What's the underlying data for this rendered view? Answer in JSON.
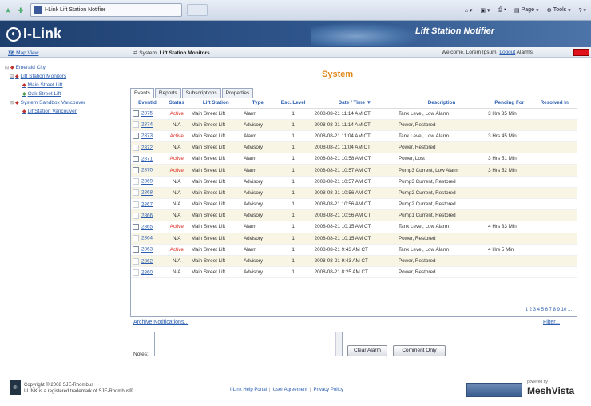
{
  "browser": {
    "tab_title": "I-Link Lift Station Notifier",
    "page_label": "Page",
    "tools_label": "Tools"
  },
  "banner": {
    "logo_text": "I-Link",
    "app_title": "Lift Station Notifier"
  },
  "subbar": {
    "map_view": "Map View",
    "system_prefix": "System:",
    "system_name": "Lift Station Monitors",
    "welcome": "Welcome, Lorem Ipsum",
    "logout": "Logout",
    "alarms_label": "Alarms:",
    "alarm_color": "#e0121b"
  },
  "sidebar": {
    "items": [
      {
        "label": "Emerald City",
        "level": 0,
        "expander": "⊟"
      },
      {
        "label": "Lift Station Monitors",
        "level": 1,
        "expander": "⊟"
      },
      {
        "label": "Main Street Lift",
        "level": 2,
        "expander": ""
      },
      {
        "label": "Oak Street Lift",
        "level": 2,
        "expander": ""
      },
      {
        "label": "System Sandbox Vancouver",
        "level": 1,
        "expander": "⊟"
      },
      {
        "label": "LiftStation Vancouver",
        "level": 2,
        "expander": ""
      }
    ]
  },
  "main": {
    "title": "System",
    "tabs": [
      "Events",
      "Reports",
      "Subscriptions",
      "Properties"
    ],
    "active_tab": "Events",
    "columns": [
      "EventId",
      "Status",
      "Lift Station",
      "Type",
      "Esc. Level",
      "Date / Time ▼",
      "Description",
      "Pending For",
      "Resolved In"
    ],
    "rows": [
      {
        "id": "2875",
        "status": "Active",
        "station": "Main Street Lift",
        "type": "Alarm",
        "level": "1",
        "datetime": "2008-08-21 11:14 AM CT",
        "description": "Tank Level, Low Alarm",
        "pending": "3 Hrs 35 Min",
        "resolved": ""
      },
      {
        "id": "2874",
        "status": "N/A",
        "station": "Main Street Lift",
        "type": "Advisory",
        "level": "1",
        "datetime": "2008-08-21 11:14 AM CT",
        "description": "Power, Restored",
        "pending": "",
        "resolved": ""
      },
      {
        "id": "2873",
        "status": "Active",
        "station": "Main Street Lift",
        "type": "Alarm",
        "level": "1",
        "datetime": "2008-08-21 11:04 AM CT",
        "description": "Tank Level, Low Alarm",
        "pending": "3 Hrs 45 Min",
        "resolved": ""
      },
      {
        "id": "2872",
        "status": "N/A",
        "station": "Main Street Lift",
        "type": "Advisory",
        "level": "1",
        "datetime": "2008-08-21 11:04 AM CT",
        "description": "Power, Restored",
        "pending": "",
        "resolved": ""
      },
      {
        "id": "2871",
        "status": "Active",
        "station": "Main Street Lift",
        "type": "Alarm",
        "level": "1",
        "datetime": "2008-08-21 10:58 AM CT",
        "description": "Power, Lost",
        "pending": "3 Hrs 51 Min",
        "resolved": ""
      },
      {
        "id": "2870",
        "status": "Active",
        "station": "Main Street Lift",
        "type": "Alarm",
        "level": "1",
        "datetime": "2008-08-21 10:57 AM CT",
        "description": "Pump3 Current, Low Alarm",
        "pending": "3 Hrs 52 Min",
        "resolved": ""
      },
      {
        "id": "2869",
        "status": "N/A",
        "station": "Main Street Lift",
        "type": "Advisory",
        "level": "1",
        "datetime": "2008-08-21 10:57 AM CT",
        "description": "Pump3 Current, Restored",
        "pending": "",
        "resolved": ""
      },
      {
        "id": "2868",
        "status": "N/A",
        "station": "Main Street Lift",
        "type": "Advisory",
        "level": "1",
        "datetime": "2008-08-21 10:56 AM CT",
        "description": "Pump2 Current, Restored",
        "pending": "",
        "resolved": ""
      },
      {
        "id": "2867",
        "status": "N/A",
        "station": "Main Street Lift",
        "type": "Advisory",
        "level": "1",
        "datetime": "2008-08-21 10:56 AM CT",
        "description": "Pump2 Current, Restored",
        "pending": "",
        "resolved": ""
      },
      {
        "id": "2866",
        "status": "N/A",
        "station": "Main Street Lift",
        "type": "Advisory",
        "level": "1",
        "datetime": "2008-08-21 10:56 AM CT",
        "description": "Pump1 Current, Restored",
        "pending": "",
        "resolved": ""
      },
      {
        "id": "2865",
        "status": "Active",
        "station": "Main Street Lift",
        "type": "Alarm",
        "level": "1",
        "datetime": "2008-08-21 10:15 AM CT",
        "description": "Tank Level, Low Alarm",
        "pending": "4 Hrs 33 Min",
        "resolved": ""
      },
      {
        "id": "2864",
        "status": "N/A",
        "station": "Main Street Lift",
        "type": "Advisory",
        "level": "1",
        "datetime": "2008-08-21 10:15 AM CT",
        "description": "Power, Restored",
        "pending": "",
        "resolved": ""
      },
      {
        "id": "2863",
        "status": "Active",
        "station": "Main Street Lift",
        "type": "Alarm",
        "level": "1",
        "datetime": "2008-08-21 9:43 AM CT",
        "description": "Tank Level, Low Alarm",
        "pending": "4 Hrs 5 Min",
        "resolved": ""
      },
      {
        "id": "2862",
        "status": "N/A",
        "station": "Main Street Lift",
        "type": "Advisory",
        "level": "1",
        "datetime": "2008-08-21 9:43 AM CT",
        "description": "Power, Restored",
        "pending": "",
        "resolved": ""
      },
      {
        "id": "2860",
        "status": "N/A",
        "station": "Main Street Lift",
        "type": "Advisory",
        "level": "1",
        "datetime": "2008-08-21 8:25 AM CT",
        "description": "Power, Restored",
        "pending": "",
        "resolved": ""
      }
    ],
    "pager": "1 2 3 4 5 6 7 8 9 10 ...",
    "archive_link": "Archive Notifications...",
    "filter_link": "Filter...",
    "notes_label": "Notes:",
    "notes_value": "",
    "clear_alarm": "Clear Alarm",
    "comment_only": "Comment Only",
    "active_color": "#d9261c",
    "link_color": "#2a5db0",
    "title_color": "#e08a1c"
  },
  "footer": {
    "copyright": "Copyright © 2008 SJE-Rhombus",
    "trademark": "I-LINK is a registered trademark of SJE-Rhombus®",
    "links": [
      "I-Link Help Portal",
      "User Agreement",
      "Privacy Policy"
    ],
    "powered_by": "powered by",
    "brand": "MeshVista"
  }
}
